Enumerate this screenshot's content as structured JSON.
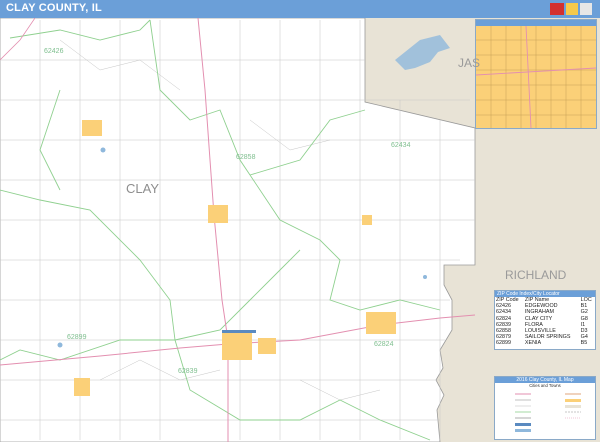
{
  "header": {
    "title": "CLAY COUNTY, IL"
  },
  "labels": {
    "county": "CLAY",
    "neighbor_north": "JAS",
    "neighbor_east": "RICHLAND"
  },
  "zip_labels": [
    {
      "text": "62426"
    },
    {
      "text": "62858"
    },
    {
      "text": "62434"
    },
    {
      "text": "62899"
    },
    {
      "text": "62839"
    },
    {
      "text": "62824"
    }
  ],
  "zip_index": {
    "title": "ZIP Code Index/City Locator",
    "columns": [
      "ZIP Code",
      "ZIP Name",
      "LOC"
    ],
    "rows": [
      [
        "62426",
        "EDGEWOOD",
        "B1"
      ],
      [
        "62434",
        "INGRAHAM",
        "G2"
      ],
      [
        "62824",
        "CLAY CITY",
        "G8"
      ],
      [
        "62839",
        "FLORA",
        "I1"
      ],
      [
        "62858",
        "LOUISVILLE",
        "D3"
      ],
      [
        "62879",
        "SAILOR SPRINGS",
        "G4"
      ],
      [
        "62899",
        "XENIA",
        "B5"
      ]
    ]
  },
  "legend": {
    "title": "2016 Clay County, IL Map",
    "subtitle": "Cities and Towns"
  },
  "colors": {
    "header_bg": "#6b9fd8",
    "county_fill": "#ffffff",
    "outside_fill": "#e8e3d6",
    "town_fill": "#fbd078",
    "zip_boundary": "#8fd08f",
    "highway": "#e38fb0",
    "road": "#c6c6c6",
    "water": "#8fb8dc"
  }
}
